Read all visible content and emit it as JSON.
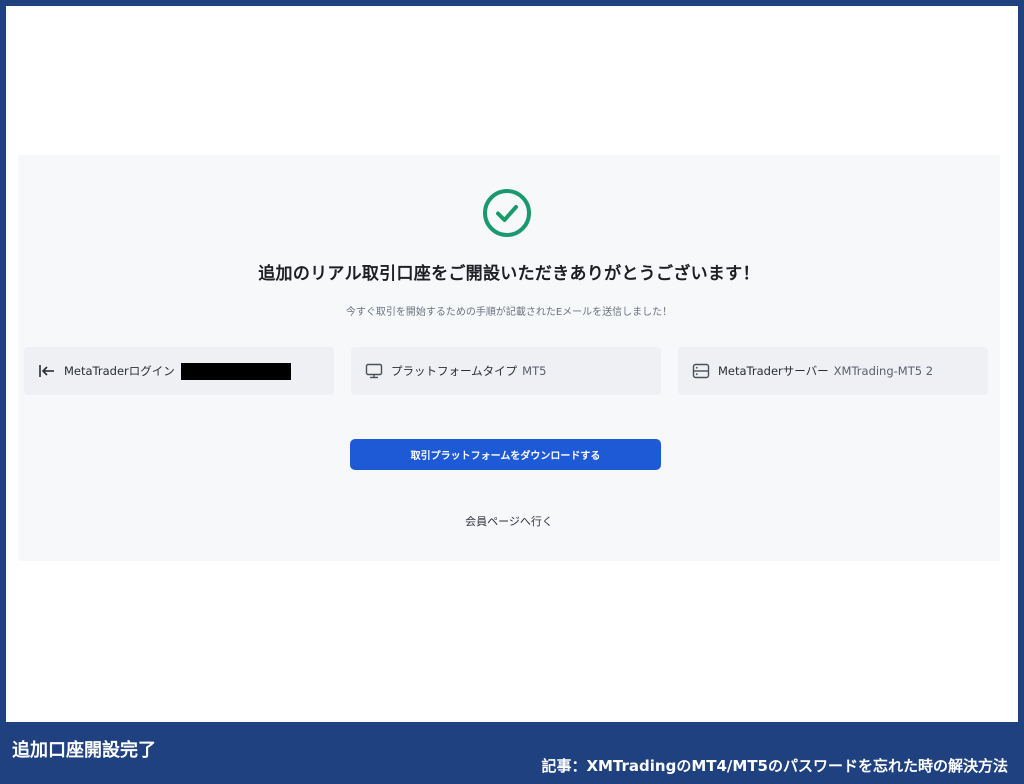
{
  "colors": {
    "frame_border": "#1f4180",
    "panel_bg": "#f7f8fa",
    "success_green": "#1a9a6c",
    "primary_button": "#1f5ad6"
  },
  "success": {
    "icon": "check-circle-icon",
    "headline": "追加のリアル取引口座をご開設いただきありがとうございます！",
    "subtext": "今すぐ取引を開始するための手順が記載されたEメールを送信しました！"
  },
  "info_cards": [
    {
      "icon": "login-arrow-icon",
      "label": "MetaTraderログイン",
      "value": ""
    },
    {
      "icon": "monitor-icon",
      "label": "プラットフォームタイプ",
      "value": "MT5"
    },
    {
      "icon": "server-icon",
      "label": "MetaTraderサーバー",
      "value": "XMTrading-MT5 2"
    }
  ],
  "actions": {
    "download_label": "取引プラットフォームをダウンロードする",
    "member_page_link": "会員ページへ行く"
  },
  "captions": {
    "left": "追加口座開設完了",
    "right": "記事：XMTradingのMT4/MT5のパスワードを忘れた時の解決方法"
  }
}
